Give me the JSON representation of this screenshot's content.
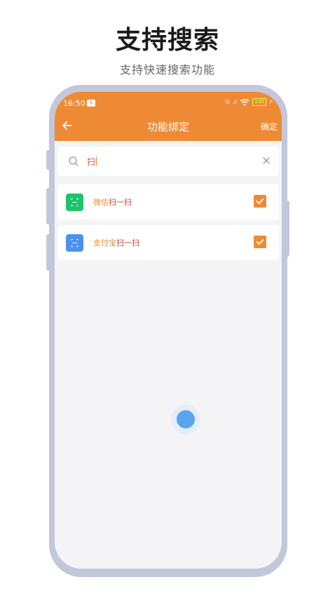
{
  "promo": {
    "title": "支持搜索",
    "subtitle": "支持快速搜索功能"
  },
  "status_bar": {
    "time": "16:50",
    "battery": "100"
  },
  "header": {
    "title": "功能绑定",
    "confirm_label": "确定",
    "background_color": "#ee8a34"
  },
  "search": {
    "value": "扫",
    "placeholder": ""
  },
  "items": [
    {
      "label_prefix": "微信",
      "label_match": "扫一扫",
      "icon": "wechat-scan-icon",
      "icon_color": "#1fc36a",
      "checked": true
    },
    {
      "label_prefix": "支付宝",
      "label_match": "扫一扫",
      "icon": "alipay-scan-icon",
      "icon_color": "#4a92f0",
      "checked": true
    }
  ],
  "colors": {
    "accent": "#ee8a34",
    "highlight": "#d63b3b",
    "loading": "#5aa4f0"
  }
}
